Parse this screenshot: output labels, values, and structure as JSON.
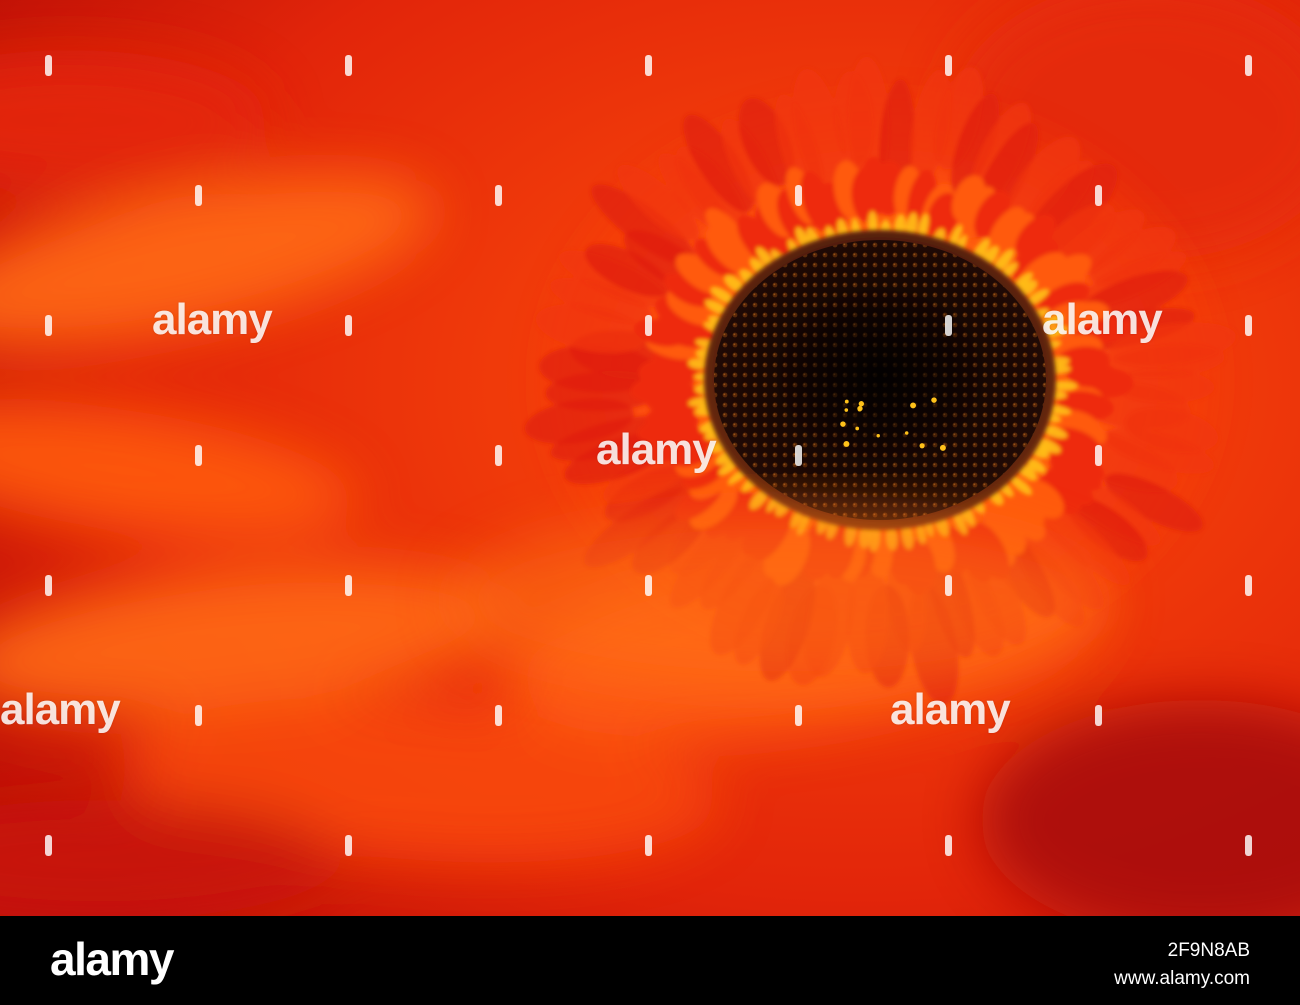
{
  "photo": {
    "subject": "Close-up of a red gerbera daisy with a dark centre and yellow-tipped florets",
    "colors": {
      "petal_red": "#e0200a",
      "petal_orange": "#ff5a10",
      "floret_yellow": "#ffc21a",
      "center_dark": "#120604"
    }
  },
  "watermark": {
    "text": "alamy"
  },
  "footer": {
    "logo": "alamy",
    "image_id": "2F9N8AB",
    "url": "www.alamy.com"
  }
}
